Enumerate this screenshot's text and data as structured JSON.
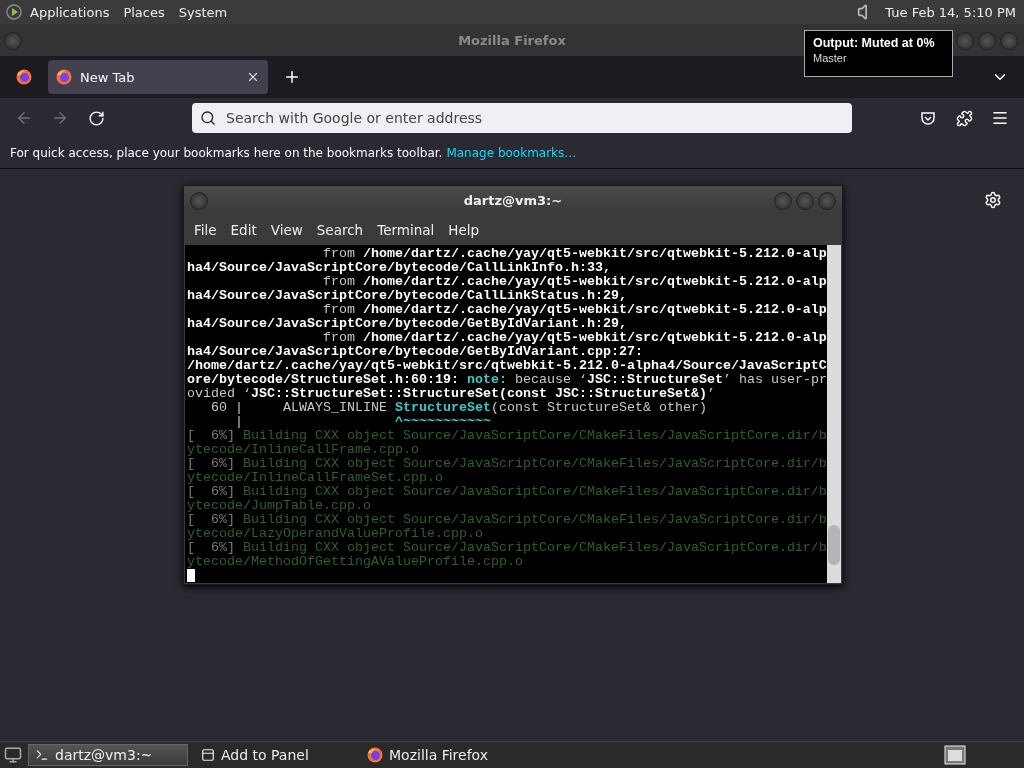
{
  "top_panel": {
    "menus": [
      "Applications",
      "Places",
      "System"
    ],
    "clock": "Tue Feb 14,  5:10 PM"
  },
  "volume_tooltip": {
    "title": "Output: Muted at 0%",
    "subtitle": "Master"
  },
  "browser": {
    "window_title": "Mozilla Firefox",
    "tabs": [
      {
        "label": "New Tab",
        "selected": true
      }
    ],
    "back_disabled": true,
    "forward_disabled": true,
    "address": {
      "placeholder": "Search with Google or enter address"
    },
    "bookmarks_hint": "For quick access, place your bookmarks here on the bookmarks toolbar.",
    "bookmarks_link": "Manage bookmarks…"
  },
  "terminal": {
    "title": "dartz@vm3:~",
    "menus": [
      "File",
      "Edit",
      "View",
      "Search",
      "Terminal",
      "Help"
    ],
    "lines": [
      [
        {
          "kind": "plain",
          "text": "                 from "
        },
        {
          "kind": "bold",
          "text": "/home/dartz/.cache/yay/qt5-webkit/src/qtwebkit-5.212.0-alp"
        }
      ],
      [
        {
          "kind": "bold",
          "text": "ha4/Source/JavaScriptCore/bytecode/CallLinkInfo.h:33,"
        }
      ],
      [
        {
          "kind": "plain",
          "text": "                 from "
        },
        {
          "kind": "bold",
          "text": "/home/dartz/.cache/yay/qt5-webkit/src/qtwebkit-5.212.0-alp"
        }
      ],
      [
        {
          "kind": "bold",
          "text": "ha4/Source/JavaScriptCore/bytecode/CallLinkStatus.h:29,"
        }
      ],
      [
        {
          "kind": "plain",
          "text": "                 from "
        },
        {
          "kind": "bold",
          "text": "/home/dartz/.cache/yay/qt5-webkit/src/qtwebkit-5.212.0-alp"
        }
      ],
      [
        {
          "kind": "bold",
          "text": "ha4/Source/JavaScriptCore/bytecode/GetByIdVariant.h:29,"
        }
      ],
      [
        {
          "kind": "plain",
          "text": "                 from "
        },
        {
          "kind": "bold",
          "text": "/home/dartz/.cache/yay/qt5-webkit/src/qtwebkit-5.212.0-alp"
        }
      ],
      [
        {
          "kind": "bold",
          "text": "ha4/Source/JavaScriptCore/bytecode/GetByIdVariant.cpp:27:"
        }
      ],
      [
        {
          "kind": "bold",
          "text": "/home/dartz/.cache/yay/qt5-webkit/src/qtwebkit-5.212.0-alpha4/Source/JavaScriptC"
        }
      ],
      [
        {
          "kind": "bold",
          "text": "ore/bytecode/StructureSet.h:60:19: "
        },
        {
          "kind": "cyan",
          "text": "note:"
        },
        {
          "kind": "plain",
          "text": " because ‘"
        },
        {
          "kind": "bold",
          "text": "JSC::StructureSet"
        },
        {
          "kind": "plain",
          "text": "’ has user-pr"
        }
      ],
      [
        {
          "kind": "plain",
          "text": "ovided ‘"
        },
        {
          "kind": "bold",
          "text": "JSC::StructureSet::StructureSet(const JSC::StructureSet&)"
        },
        {
          "kind": "plain",
          "text": "’"
        }
      ],
      [
        {
          "kind": "plain",
          "text": "   60 |     ALWAYS_INLINE "
        },
        {
          "kind": "cyan",
          "text": "StructureSet"
        },
        {
          "kind": "plain",
          "text": "(const StructureSet& other)"
        }
      ],
      [
        {
          "kind": "plain",
          "text": "      |                   "
        },
        {
          "kind": "cyan",
          "text": "^~~~~~~~~~~~"
        }
      ],
      [
        {
          "kind": "dim",
          "text": "[  6%] "
        },
        {
          "kind": "green",
          "text": "Building CXX object Source/JavaScriptCore/CMakeFiles/JavaScriptCore.dir/b"
        }
      ],
      [
        {
          "kind": "green",
          "text": "ytecode/InlineCallFrame.cpp.o"
        }
      ],
      [
        {
          "kind": "dim",
          "text": "[  6%] "
        },
        {
          "kind": "green",
          "text": "Building CXX object Source/JavaScriptCore/CMakeFiles/JavaScriptCore.dir/b"
        }
      ],
      [
        {
          "kind": "green",
          "text": "ytecode/InlineCallFrameSet.cpp.o"
        }
      ],
      [
        {
          "kind": "dim",
          "text": "[  6%] "
        },
        {
          "kind": "green",
          "text": "Building CXX object Source/JavaScriptCore/CMakeFiles/JavaScriptCore.dir/b"
        }
      ],
      [
        {
          "kind": "green",
          "text": "ytecode/JumpTable.cpp.o"
        }
      ],
      [
        {
          "kind": "dim",
          "text": "[  6%] "
        },
        {
          "kind": "green",
          "text": "Building CXX object Source/JavaScriptCore/CMakeFiles/JavaScriptCore.dir/b"
        }
      ],
      [
        {
          "kind": "green",
          "text": "ytecode/LazyOperandValueProfile.cpp.o"
        }
      ],
      [
        {
          "kind": "dim",
          "text": "[  6%] "
        },
        {
          "kind": "green",
          "text": "Building CXX object Source/JavaScriptCore/CMakeFiles/JavaScriptCore.dir/b"
        }
      ],
      [
        {
          "kind": "green",
          "text": "ytecode/MethodOfGettingAValueProfile.cpp.o"
        }
      ]
    ]
  },
  "taskbar": [
    {
      "kind": "terminal",
      "label": "dartz@vm3:~",
      "selected": true
    },
    {
      "kind": "applet",
      "label": "Add to Panel",
      "selected": false
    },
    {
      "kind": "firefox",
      "label": "Mozilla Firefox",
      "selected": false
    }
  ]
}
